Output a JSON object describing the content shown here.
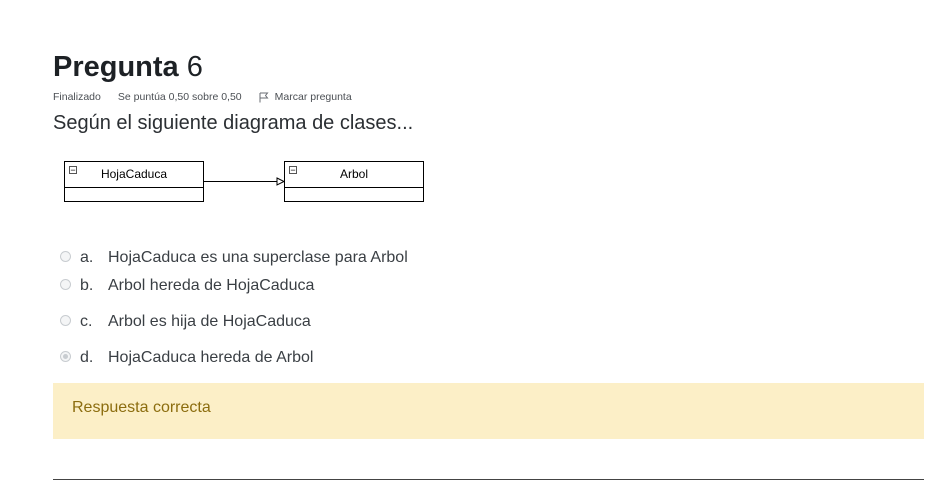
{
  "question": {
    "heading": "Pregunta",
    "number": "6",
    "status": "Finalizado",
    "score": "Se puntúa 0,50 sobre 0,50",
    "flag_label": "Marcar pregunta",
    "text": "Según el siguiente diagrama de clases..."
  },
  "diagram": {
    "left_class": "HojaCaduca",
    "right_class": "Arbol",
    "collapse_glyph": "−"
  },
  "answers": [
    {
      "letter": "a.",
      "text": "HojaCaduca es una superclase para Arbol",
      "selected": false
    },
    {
      "letter": "b.",
      "text": "Arbol hereda de HojaCaduca",
      "selected": false
    },
    {
      "letter": "c.",
      "text": "Arbol es hija de HojaCaduca",
      "selected": false
    },
    {
      "letter": "d.",
      "text": "HojaCaduca hereda de Arbol",
      "selected": true
    }
  ],
  "feedback": {
    "text": "Respuesta correcta"
  }
}
